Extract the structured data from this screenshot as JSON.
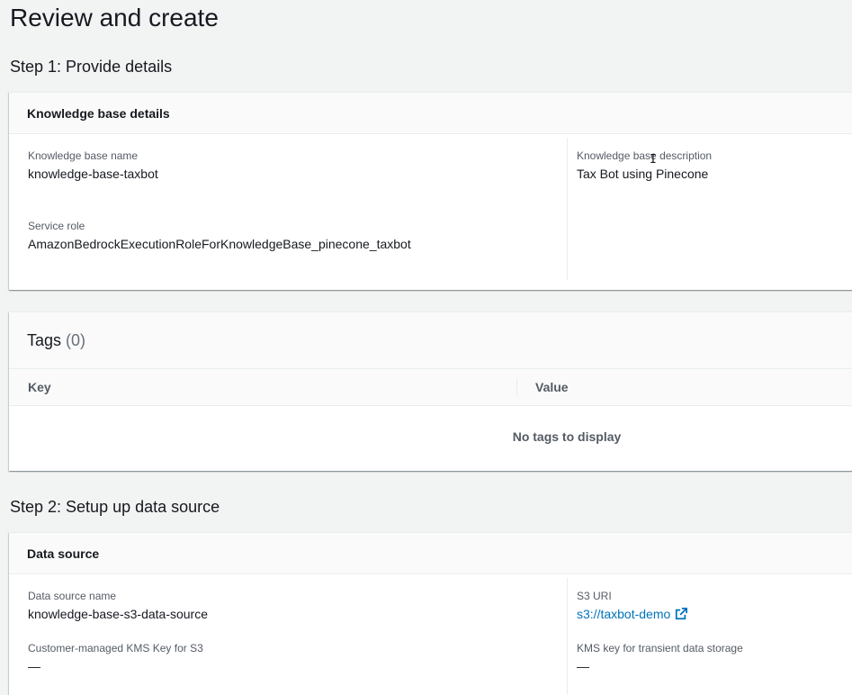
{
  "page": {
    "title": "Review and create"
  },
  "step1": {
    "title": "Step 1: Provide details",
    "kb_details": {
      "header": "Knowledge base details",
      "name_label": "Knowledge base name",
      "name_value": "knowledge-base-taxbot",
      "role_label": "Service role",
      "role_value": "AmazonBedrockExecutionRoleForKnowledgeBase_pinecone_taxbot",
      "desc_label": "Knowledge base description",
      "desc_value": "Tax Bot using Pinecone"
    },
    "tags": {
      "title": "Tags",
      "count": "(0)",
      "columns": [
        "Key",
        "Value"
      ],
      "empty_text": "No tags to display"
    }
  },
  "step2": {
    "title": "Step 2: Setup up data source",
    "data_source": {
      "header": "Data source",
      "name_label": "Data source name",
      "name_value": "knowledge-base-s3-data-source",
      "s3_label": "S3 URI",
      "s3_value": "s3://taxbot-demo",
      "kms_s3_label": "Customer-managed KMS Key for S3",
      "kms_s3_value": "—",
      "kms_transient_label": "KMS key for transient data storage",
      "kms_transient_value": "—"
    }
  },
  "icons": {
    "external_link": "external-link-icon",
    "cursor": "text-cursor-icon"
  },
  "colors": {
    "link": "#0073bb",
    "background": "#f2f3f3"
  }
}
